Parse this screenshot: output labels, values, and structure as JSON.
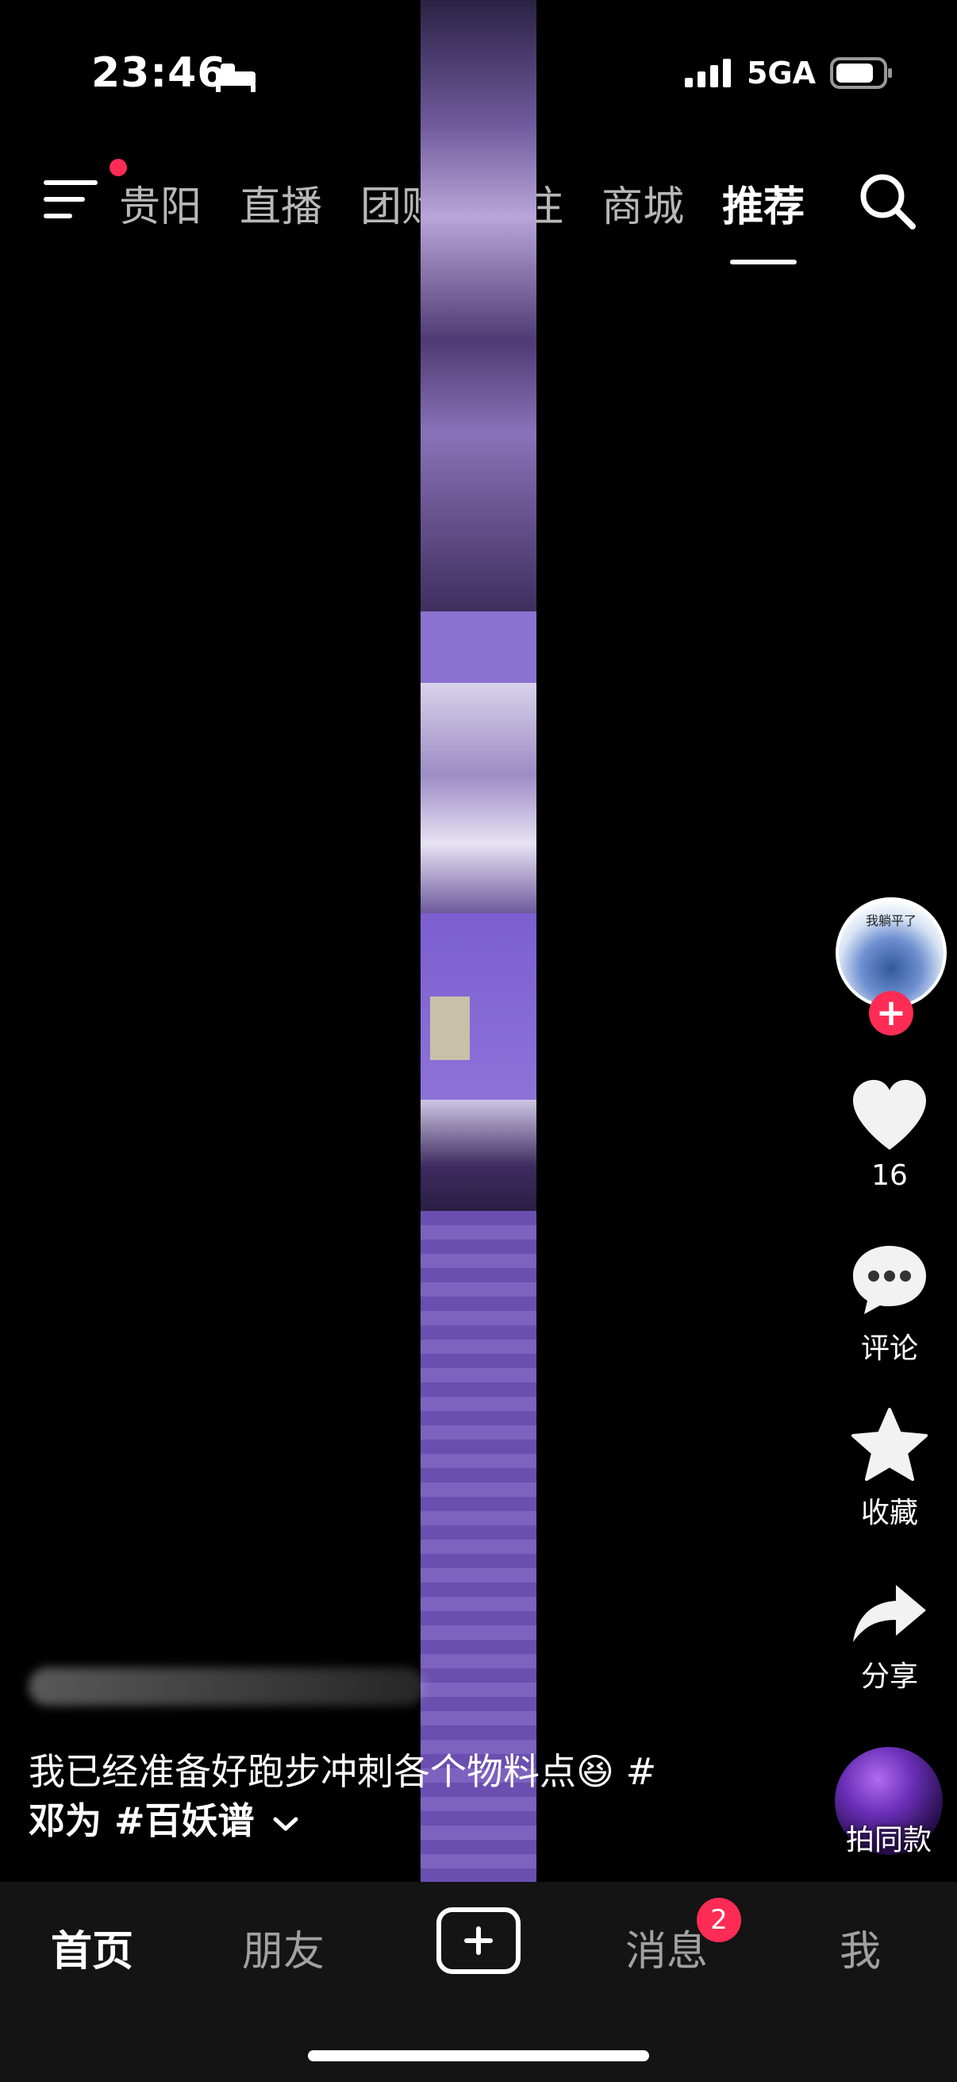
{
  "status": {
    "time": "23:46",
    "network": "5GA"
  },
  "top_tabs": [
    {
      "label": "贵阳",
      "active": false
    },
    {
      "label": "直播",
      "active": false
    },
    {
      "label": "团购",
      "active": false
    },
    {
      "label": "关注",
      "active": false
    },
    {
      "label": "商城",
      "active": false
    },
    {
      "label": "推荐",
      "active": true
    }
  ],
  "icons": {
    "menu": "menu-icon",
    "search": "search-icon",
    "like": "heart-icon",
    "comment": "comment-icon",
    "favorite": "star-icon",
    "share": "share-icon"
  },
  "creator": {
    "avatar_caption": "我躺平了"
  },
  "actions": {
    "like_count": "16",
    "comment_label": "评论",
    "favorite_label": "收藏",
    "share_label": "分享",
    "same_style_label": "拍同款"
  },
  "caption": {
    "text": "我已经准备好跑步冲刺各个物料点😆 #",
    "text2": "邓为 #百妖谱"
  },
  "bottom_nav": [
    {
      "label": "首页",
      "active": true
    },
    {
      "label": "朋友",
      "active": false
    },
    {
      "label": "消息",
      "active": false,
      "badge": "2"
    },
    {
      "label": "我",
      "active": false
    }
  ],
  "colors": {
    "accent": "#fe2c55",
    "video_purple": "#6b4bb0"
  }
}
